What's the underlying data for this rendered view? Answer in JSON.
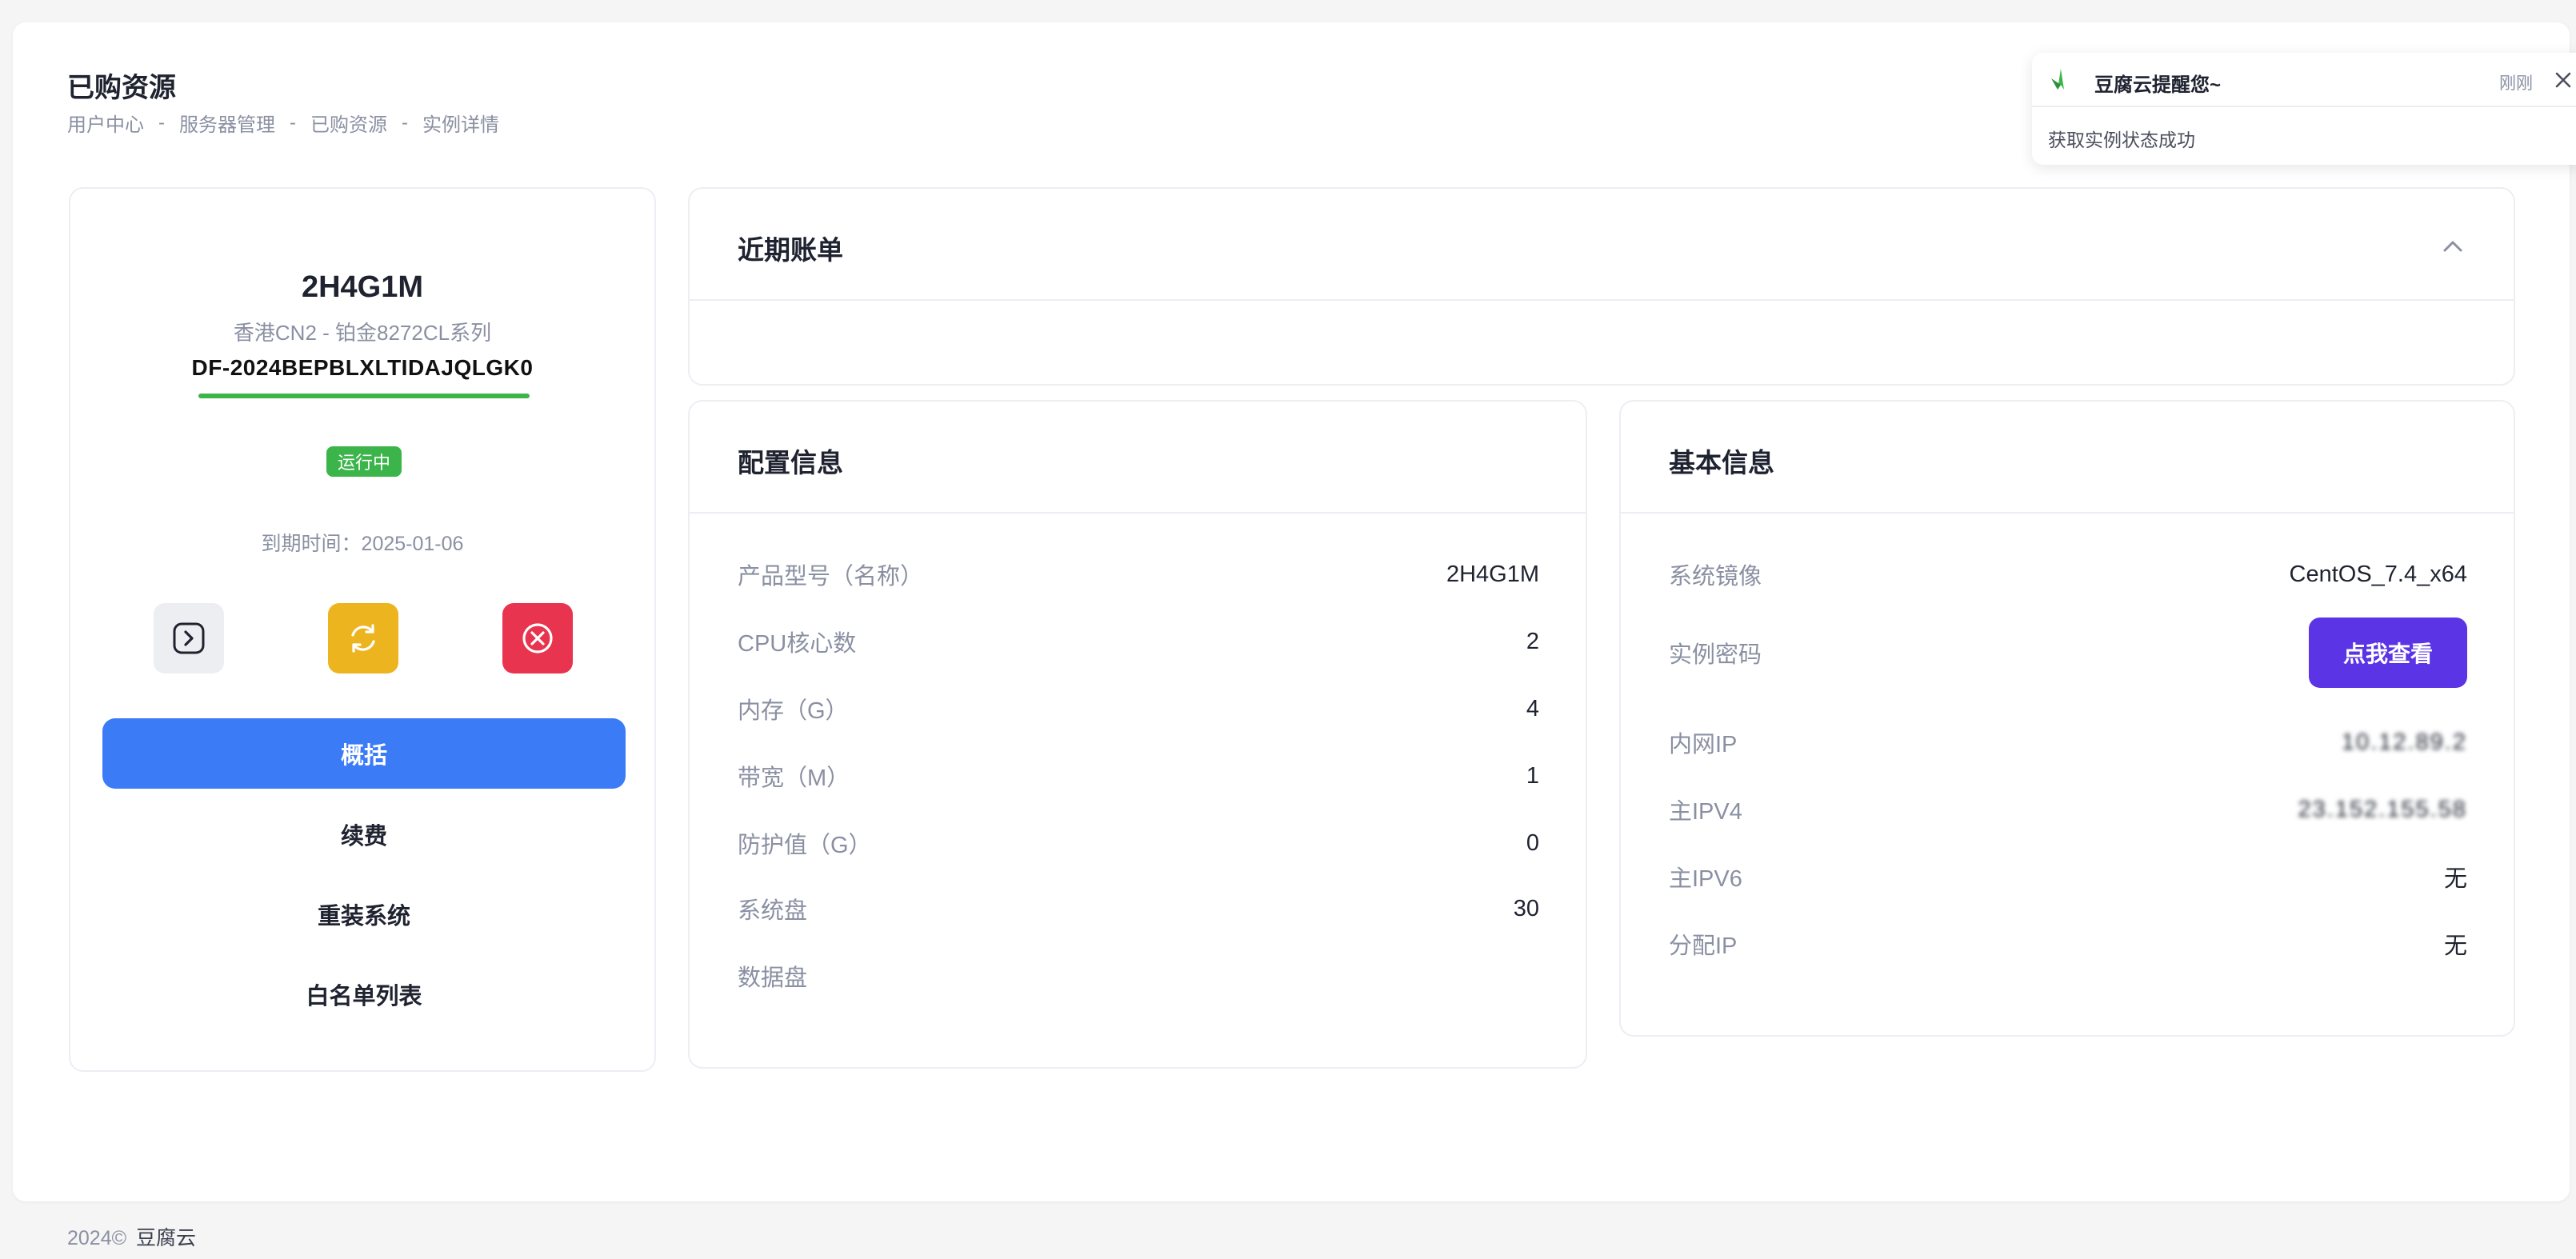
{
  "page": {
    "title": "已购资源",
    "breadcrumb": [
      "用户中心",
      "服务器管理",
      "已购资源",
      "实例详情"
    ],
    "breadcrumb_sep": "-"
  },
  "instance": {
    "name": "2H4G1M",
    "subtitle": "香港CN2 - 铂金8272CL系列",
    "id": "DF-2024BEPBLXLTIDAJQLGK0",
    "status": "运行中",
    "status_color": "#3bb54a",
    "expire": "到期时间：2025-01-06"
  },
  "actions": [
    {
      "icon": "console-icon",
      "color": "#eceef1"
    },
    {
      "icon": "restart-icon",
      "color": "#ecb41f"
    },
    {
      "icon": "stop-icon",
      "color": "#e8344e"
    }
  ],
  "menu": {
    "overview": "概括",
    "renew": "续费",
    "reinstall": "重装系统",
    "whitelist": "白名单列表",
    "active_color": "#3b7bf6"
  },
  "bills": {
    "title": "近期账单"
  },
  "config": {
    "title": "配置信息",
    "rows": [
      {
        "label": "产品型号（名称）",
        "value": "2H4G1M"
      },
      {
        "label": "CPU核心数",
        "value": "2"
      },
      {
        "label": "内存（G）",
        "value": "4"
      },
      {
        "label": "带宽（M）",
        "value": "1"
      },
      {
        "label": "防护值（G）",
        "value": "0"
      },
      {
        "label": "系统盘",
        "value": "30"
      },
      {
        "label": "数据盘",
        "value": ""
      }
    ]
  },
  "basic": {
    "title": "基本信息",
    "image_label": "系统镜像",
    "image_value": "CentOS_7.4_x64",
    "password_label": "实例密码",
    "password_button": "点我查看",
    "password_button_color": "#5b34e6",
    "private_ip_label": "内网IP",
    "private_ip_value": "10.12.89.2",
    "ipv4_label": "主IPV4",
    "ipv4_value": "23.152.155.58",
    "ipv6_label": "主IPV6",
    "ipv6_value": "无",
    "assigned_ip_label": "分配IP",
    "assigned_ip_value": "无"
  },
  "notification": {
    "title": "豆腐云提醒您~",
    "time": "刚刚",
    "message": "获取实例状态成功"
  },
  "footer": {
    "copyright": "2024©",
    "brand": "豆腐云"
  }
}
